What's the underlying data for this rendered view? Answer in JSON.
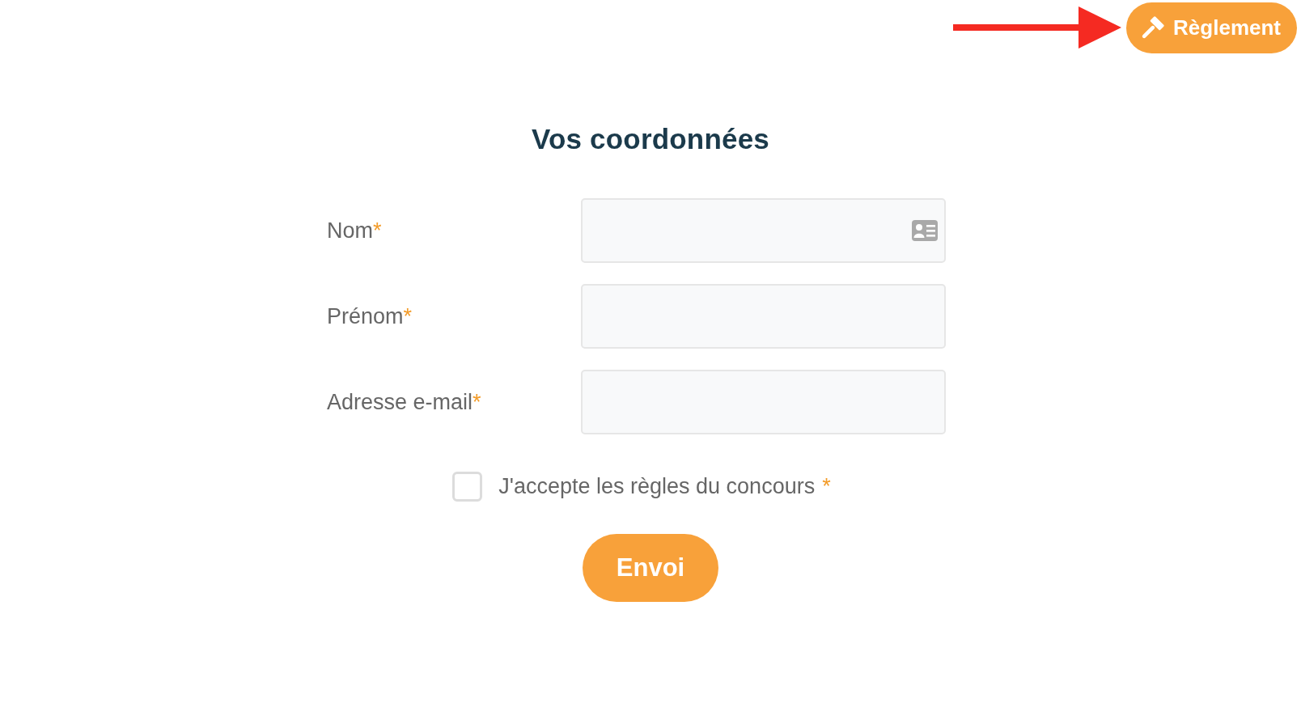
{
  "header": {
    "rules_button": {
      "label": "Règlement"
    }
  },
  "form": {
    "title": "Vos coordonnées",
    "fields": [
      {
        "label": "Nom",
        "required_mark": "*",
        "kind": "autofill"
      },
      {
        "label": "Prénom",
        "required_mark": "*",
        "kind": "text"
      },
      {
        "label": "Adresse e-mail",
        "required_mark": "*",
        "kind": "text"
      }
    ],
    "consent": {
      "label": "J'accepte les règles du concours",
      "required_mark": "*",
      "checked": false
    },
    "submit_button": {
      "label": "Envoi"
    }
  }
}
